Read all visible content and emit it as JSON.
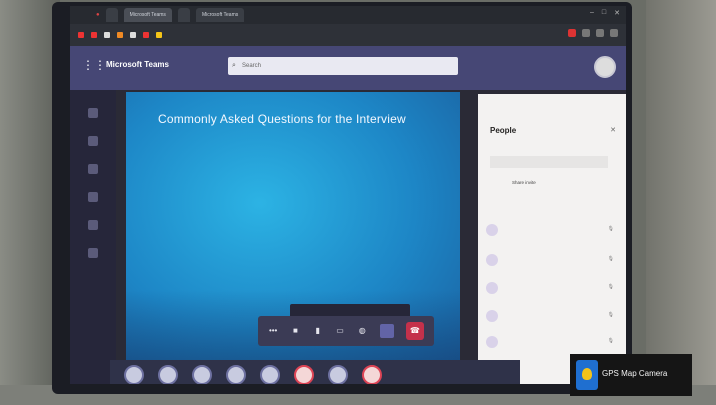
{
  "browser": {
    "tabs": [
      "",
      "Microsoft Teams",
      "",
      "Microsoft Teams"
    ],
    "bookmarks": [
      "",
      "",
      "",
      "",
      "",
      "",
      ""
    ]
  },
  "teams": {
    "app_name": "Microsoft Teams",
    "search_placeholder": "Search"
  },
  "slide": {
    "title": "Commonly Asked Questions for the Interview",
    "questions": [
      "",
      "",
      "",
      "",
      "",
      ""
    ]
  },
  "toolbar": {
    "tip": "",
    "icons": [
      "more-icon",
      "camera-icon",
      "mic-icon",
      "share-icon",
      "chat-icon",
      "people-icon"
    ]
  },
  "people": {
    "title": "People",
    "invite_placeholder": "",
    "share_invite": "Share invite",
    "section_label": "",
    "mute_all": "",
    "members": [
      {
        "name": "",
        "role": ""
      },
      {
        "name": "",
        "role": ""
      },
      {
        "name": "",
        "role": ""
      },
      {
        "name": "",
        "role": ""
      },
      {
        "name": "",
        "role": ""
      },
      {
        "name": "",
        "role": ""
      },
      {
        "name": "",
        "role": ""
      }
    ]
  },
  "watermark": {
    "label": "GPS Map Camera"
  },
  "colors": {
    "teams_purple": "#464775",
    "slide_blue": "#1d86c6",
    "hangup_red": "#c4314b"
  }
}
